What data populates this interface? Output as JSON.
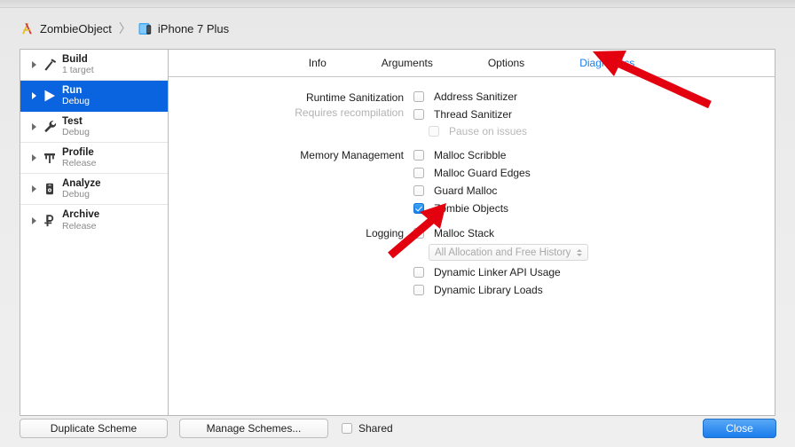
{
  "breadcrumb": {
    "project": "ZombieObject",
    "separator": "〉",
    "device": "iPhone 7 Plus",
    "project_icon": "xcode-icon",
    "device_icon": "simulator-icon"
  },
  "sidebar": {
    "items": [
      {
        "name": "Build",
        "sub": "1 target",
        "icon": "hammer-icon",
        "selected": false
      },
      {
        "name": "Run",
        "sub": "Debug",
        "icon": "play-icon",
        "selected": true
      },
      {
        "name": "Test",
        "sub": "Debug",
        "icon": "wrench-icon",
        "selected": false
      },
      {
        "name": "Profile",
        "sub": "Release",
        "icon": "instruments-icon",
        "selected": false
      },
      {
        "name": "Analyze",
        "sub": "Debug",
        "icon": "analyze-icon",
        "selected": false
      },
      {
        "name": "Archive",
        "sub": "Release",
        "icon": "archive-icon",
        "selected": false
      }
    ]
  },
  "tabs": [
    {
      "label": "Info",
      "active": false
    },
    {
      "label": "Arguments",
      "active": false
    },
    {
      "label": "Options",
      "active": false
    },
    {
      "label": "Diagnostics",
      "active": true
    }
  ],
  "sections": {
    "runtime_sanitization": {
      "label": "Runtime Sanitization",
      "sublabel": "Requires recompilation",
      "options": [
        {
          "label": "Address Sanitizer",
          "checked": false,
          "disabled": false
        },
        {
          "label": "Thread Sanitizer",
          "checked": false,
          "disabled": false
        },
        {
          "label": "Pause on issues",
          "checked": false,
          "disabled": true
        }
      ]
    },
    "memory_management": {
      "label": "Memory Management",
      "options": [
        {
          "label": "Malloc Scribble",
          "checked": false,
          "disabled": false
        },
        {
          "label": "Malloc Guard Edges",
          "checked": false,
          "disabled": false
        },
        {
          "label": "Guard Malloc",
          "checked": false,
          "disabled": false
        },
        {
          "label": "Zombie Objects",
          "checked": true,
          "disabled": false
        }
      ]
    },
    "logging": {
      "label": "Logging",
      "options": [
        {
          "label": "Malloc Stack",
          "checked": false,
          "disabled": false
        },
        {
          "label": "Dynamic Linker API Usage",
          "checked": false,
          "disabled": false
        },
        {
          "label": "Dynamic Library Loads",
          "checked": false,
          "disabled": false
        }
      ],
      "popup": {
        "value": "All Allocation and Free History",
        "disabled": true
      }
    }
  },
  "footer": {
    "duplicate_scheme": "Duplicate Scheme",
    "manage_schemes": "Manage Schemes...",
    "shared_label": "Shared",
    "shared_checked": false,
    "close": "Close"
  },
  "annotations": {
    "arrow_color": "#e3000f",
    "arrow_1_target": "Diagnostics tab",
    "arrow_2_target": "Zombie Objects checkbox"
  }
}
